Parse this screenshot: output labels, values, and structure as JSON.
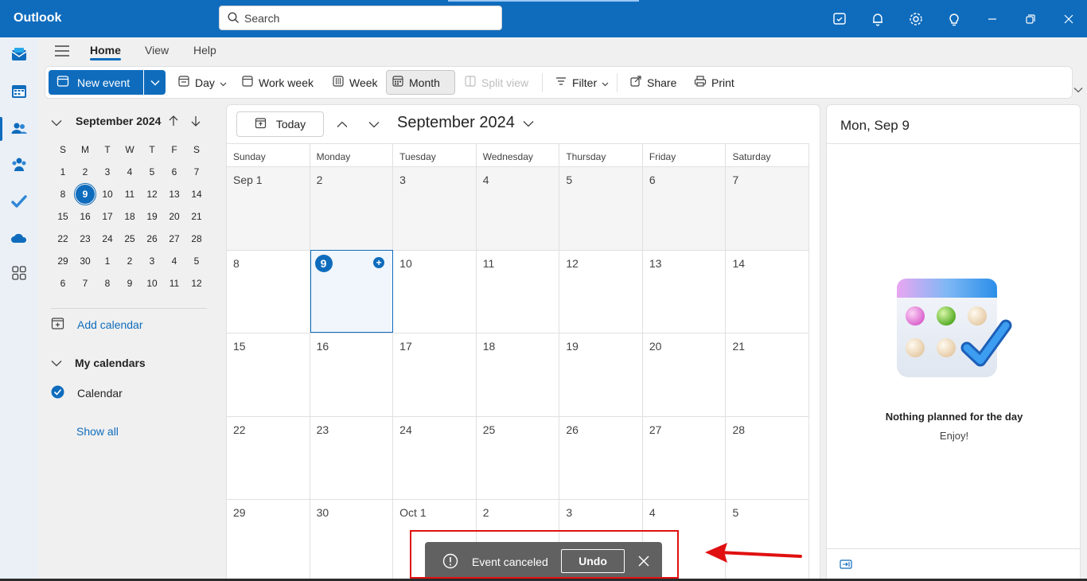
{
  "titlebar": {
    "app_name": "Outlook",
    "search_placeholder": "Search"
  },
  "menu": {
    "tabs": [
      "Home",
      "View",
      "Help"
    ]
  },
  "ribbon": {
    "new_event": "New event",
    "day": "Day",
    "work_week": "Work week",
    "week": "Week",
    "month": "Month",
    "split_view": "Split view",
    "filter": "Filter",
    "share": "Share",
    "print": "Print"
  },
  "mini_calendar": {
    "title": "September 2024",
    "weekdays": [
      "S",
      "M",
      "T",
      "W",
      "T",
      "F",
      "S"
    ],
    "weeks": [
      [
        "1",
        "2",
        "3",
        "4",
        "5",
        "6",
        "7"
      ],
      [
        "8",
        "9",
        "10",
        "11",
        "12",
        "13",
        "14"
      ],
      [
        "15",
        "16",
        "17",
        "18",
        "19",
        "20",
        "21"
      ],
      [
        "22",
        "23",
        "24",
        "25",
        "26",
        "27",
        "28"
      ],
      [
        "29",
        "30",
        "1",
        "2",
        "3",
        "4",
        "5"
      ],
      [
        "6",
        "7",
        "8",
        "9",
        "10",
        "11",
        "12"
      ]
    ],
    "today": "9"
  },
  "sidebar": {
    "add_calendar": "Add calendar",
    "my_calendars": "My calendars",
    "calendar_item": "Calendar",
    "show_all": "Show all"
  },
  "main": {
    "today_button": "Today",
    "month_title": "September 2024",
    "day_headers": [
      "Sunday",
      "Monday",
      "Tuesday",
      "Wednesday",
      "Thursday",
      "Friday",
      "Saturday"
    ],
    "weeks": [
      [
        "Sep 1",
        "2",
        "3",
        "4",
        "5",
        "6",
        "7"
      ],
      [
        "8",
        "9",
        "10",
        "11",
        "12",
        "13",
        "14"
      ],
      [
        "15",
        "16",
        "17",
        "18",
        "19",
        "20",
        "21"
      ],
      [
        "22",
        "23",
        "24",
        "25",
        "26",
        "27",
        "28"
      ],
      [
        "29",
        "30",
        "Oct 1",
        "2",
        "3",
        "4",
        "5"
      ]
    ]
  },
  "right_pane": {
    "date_title": "Mon, Sep 9",
    "empty_title": "Nothing planned for the day",
    "empty_subtitle": "Enjoy!"
  },
  "toast": {
    "message": "Event canceled",
    "undo": "Undo"
  },
  "colors": {
    "brand": "#0f6cbd",
    "toast_bg": "#616161",
    "highlight": "#e01010"
  }
}
